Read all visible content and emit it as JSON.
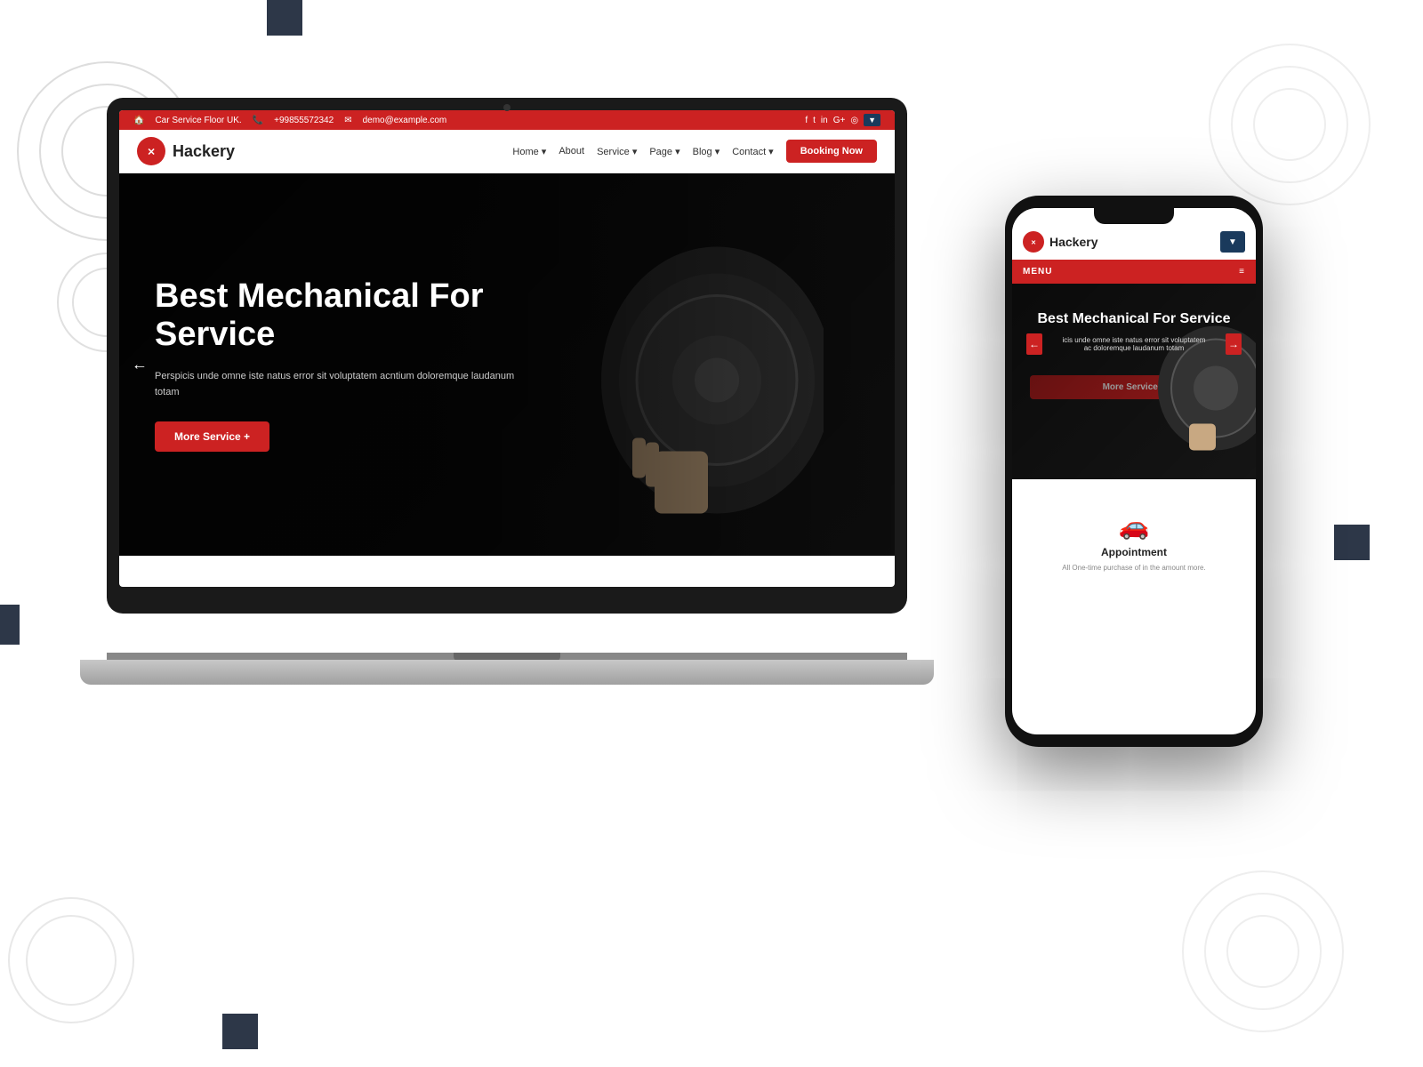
{
  "page": {
    "background": "#ffffff"
  },
  "decorative": {
    "squares": [
      "top-left",
      "mid-left",
      "right-mid",
      "bottom-left"
    ]
  },
  "laptop": {
    "topbar": {
      "address": "Car Service Floor UK.",
      "phone": "+99855572342",
      "email": "demo@example.com",
      "social_icons": [
        "facebook",
        "twitter",
        "instagram",
        "google-plus",
        "dribbble"
      ],
      "translate_icon": "globe"
    },
    "header": {
      "logo_text": "Hackery",
      "nav_items": [
        "Home",
        "About",
        "Service",
        "Page",
        "Blog",
        "Contact"
      ],
      "booking_btn": "Booking Now"
    },
    "hero": {
      "title": "Best Mechanical For Service",
      "description": "Perspicis unde omne iste natus error sit voluptatem acntium doloremque laudanum totam",
      "cta_btn": "More Service +",
      "arrow_left": "←",
      "arrow_right": "→"
    }
  },
  "phone": {
    "header": {
      "logo_text": "Hackery",
      "translate_btn": "≡"
    },
    "menu": {
      "label": "MENU",
      "hamburger": "≡"
    },
    "hero": {
      "title": "Best Mechanical For Service",
      "description": "icis unde omne iste natus error sit voluptatem ac doloremque laudanum totam",
      "cta_btn": "More Service +",
      "arrow_left": "←",
      "arrow_right": "→"
    },
    "service_section": {
      "icon": "🚗",
      "title": "Appointment",
      "description": "All One-time purchase of in the amount more."
    }
  }
}
